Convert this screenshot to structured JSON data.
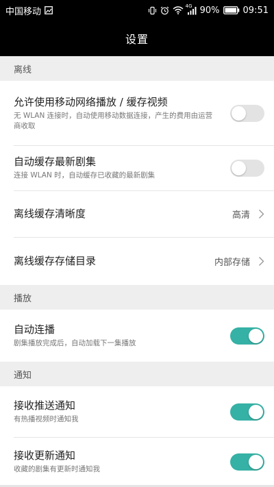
{
  "status_bar": {
    "carrier": "中国移动",
    "network_type": "4G",
    "battery": "90%",
    "time": "09:51",
    "icons": [
      "image-icon",
      "vibrate-icon",
      "alarm-icon",
      "wifi-icon",
      "signal-icon",
      "battery-icon"
    ]
  },
  "title": "设置",
  "sections": {
    "offline": {
      "header": "离线",
      "mobile_play": {
        "title": "允许使用移动网络播放 / 缓存视频",
        "desc": "无 WLAN 连接时，自动使用移动数据连接，产生的费用由运营商收取",
        "enabled": false
      },
      "auto_cache": {
        "title": "自动缓存最新剧集",
        "desc": "连接 WLAN 时，自动缓存已收藏的最新剧集",
        "enabled": false
      },
      "quality": {
        "title": "离线缓存清晰度",
        "value": "高清"
      },
      "storage": {
        "title": "离线缓存存储目录",
        "value": "内部存储"
      }
    },
    "playback": {
      "header": "播放",
      "autoplay": {
        "title": "自动连播",
        "desc": "剧集播放完成后，自动加载下一集播放",
        "enabled": true
      }
    },
    "notifications": {
      "header": "通知",
      "push": {
        "title": "接收推送通知",
        "desc": "有热播视频时通知我",
        "enabled": true
      },
      "update": {
        "title": "接收更新通知",
        "desc": "收藏的剧集有更新时通知我",
        "enabled": true
      }
    }
  },
  "colors": {
    "toggle_on": "#35b1a5",
    "toggle_off": "#e3e3e3",
    "header_bg": "#000000",
    "section_bg": "#eeeeee"
  }
}
